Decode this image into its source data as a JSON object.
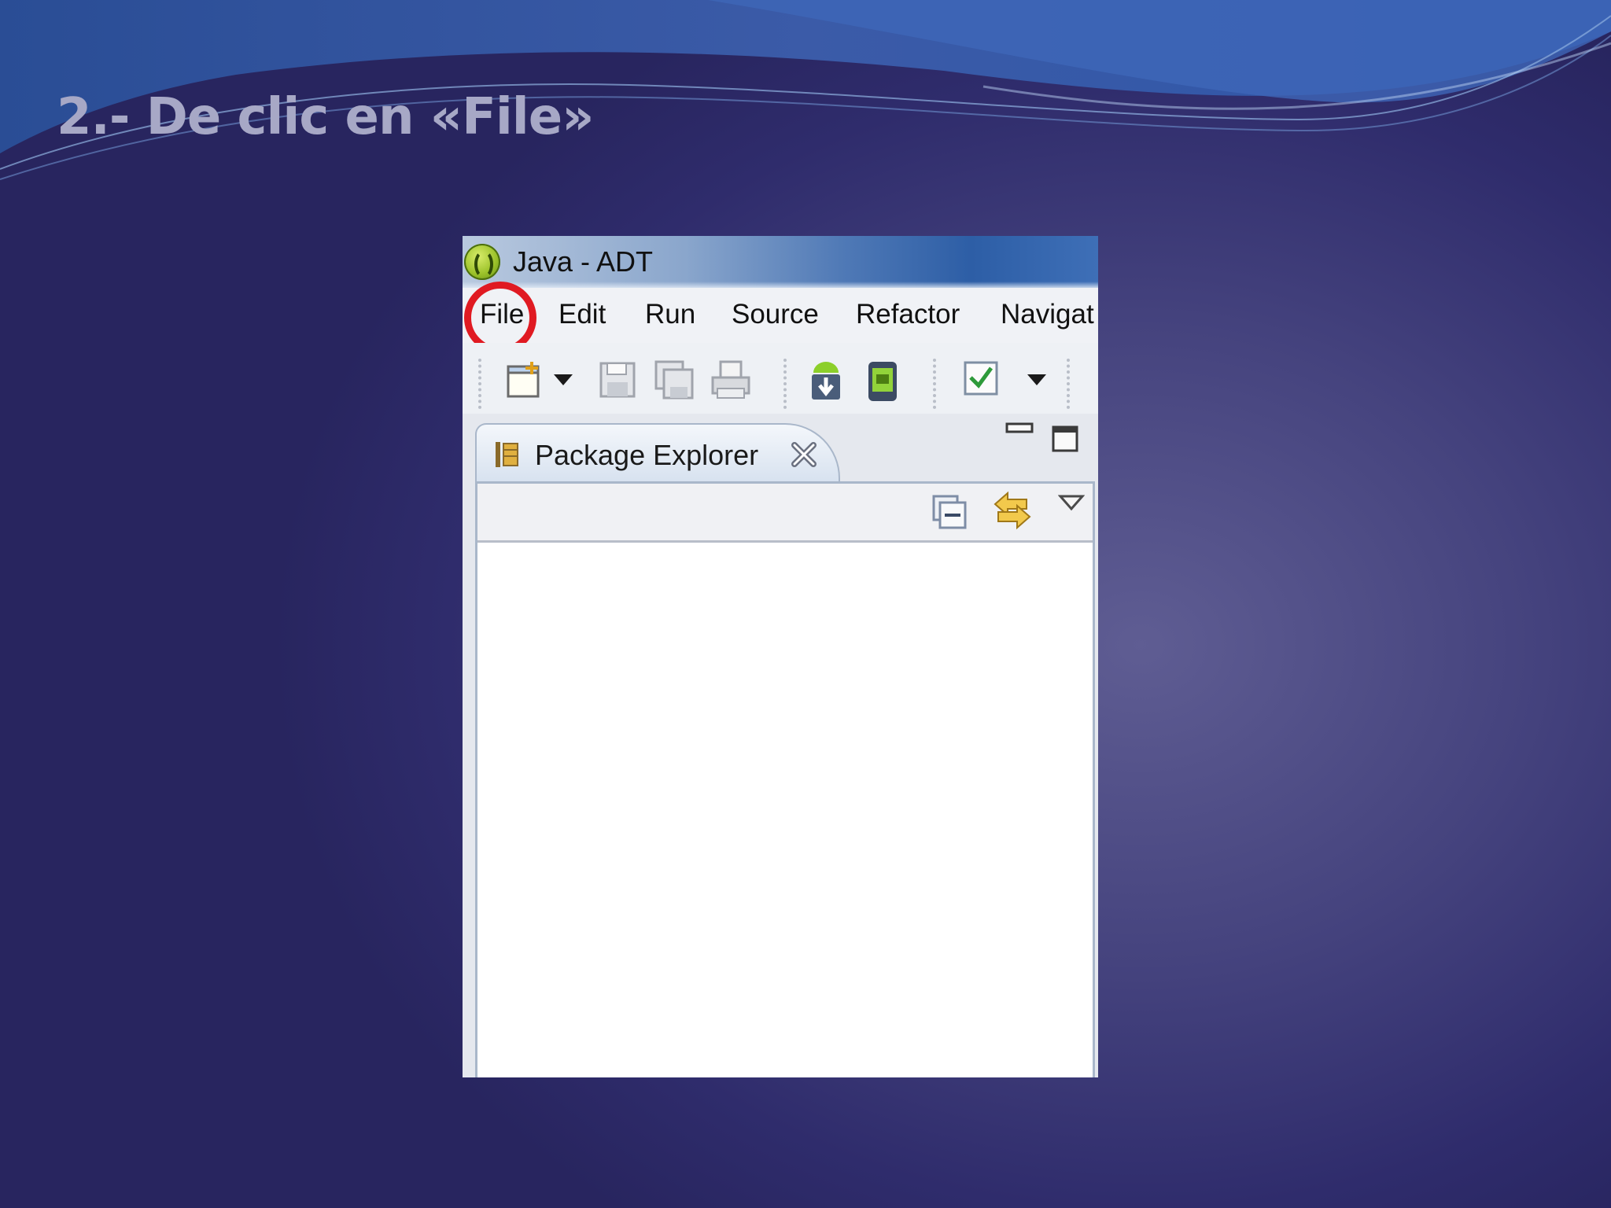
{
  "slide": {
    "title": "2.- De clic en «File»"
  },
  "window": {
    "title": "Java - ADT",
    "app_icon": "adt-logo-icon"
  },
  "menubar": {
    "items": [
      "File",
      "Edit",
      "Run",
      "Source",
      "Refactor",
      "Navigat"
    ],
    "highlighted_item": "File",
    "highlight_color": "#e01a22"
  },
  "toolbar": {
    "icons": [
      "new-icon",
      "dropdown-arrow-icon",
      "save-icon",
      "save-all-icon",
      "print-icon",
      "android-sdk-manager-icon",
      "android-avd-manager-icon",
      "task-check-icon",
      "dropdown-arrow-icon"
    ]
  },
  "view": {
    "tab_label": "Package Explorer",
    "icons": [
      "package-explorer-icon",
      "close-icon",
      "minimize-icon",
      "maximize-icon",
      "collapse-all-icon",
      "link-with-editor-icon",
      "view-menu-icon"
    ]
  }
}
